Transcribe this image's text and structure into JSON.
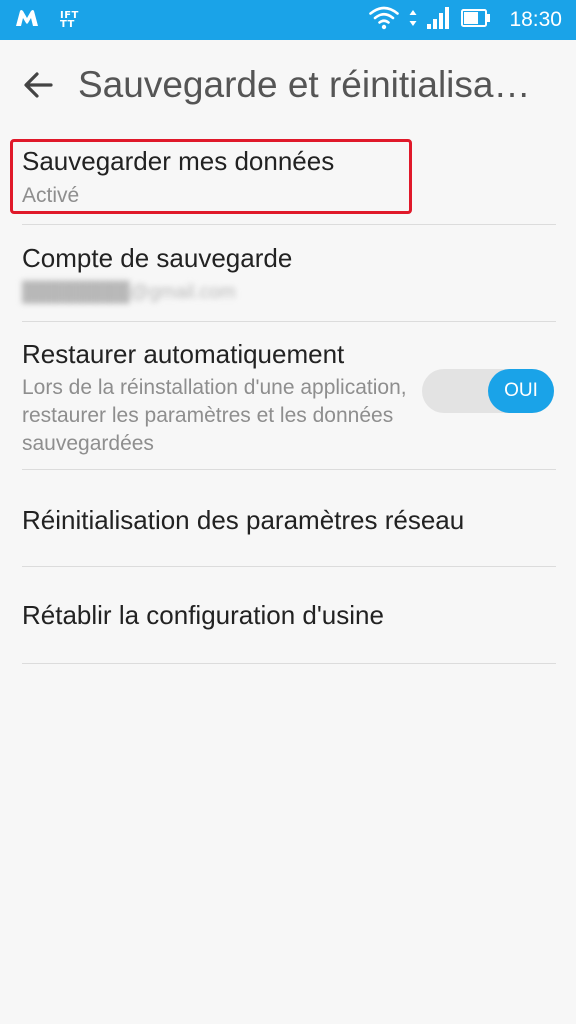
{
  "status_bar": {
    "time": "18:30",
    "ifttt_label": "IFTTT",
    "icons": [
      "malwarebytes-icon",
      "ifttt-icon",
      "wifi-icon",
      "data-arrows-icon",
      "signal-icon",
      "battery-icon"
    ],
    "color": "#1aa3e8"
  },
  "header": {
    "back_icon": "arrow-back-icon",
    "title": "Sauvegarde et réinitialisa…"
  },
  "settings": [
    {
      "title": "Sauvegarder mes données",
      "summary": "Activé",
      "highlighted": true
    },
    {
      "title": "Compte de sauvegarde",
      "summary": "████████@gmail.com",
      "summary_blurred": true
    },
    {
      "title": "Restaurer automatiquement",
      "summary": "Lors de la réinstallation d'une application, restaurer les paramètres et les données sauvegardées",
      "toggle": {
        "label": "OUI",
        "on": true
      }
    },
    {
      "title": "Réinitialisation des paramètres réseau"
    },
    {
      "title": "Rétablir la configuration d'usine"
    }
  ],
  "colors": {
    "accent": "#1aa3e8",
    "highlight": "#e0192a",
    "background": "#f7f7f7"
  }
}
